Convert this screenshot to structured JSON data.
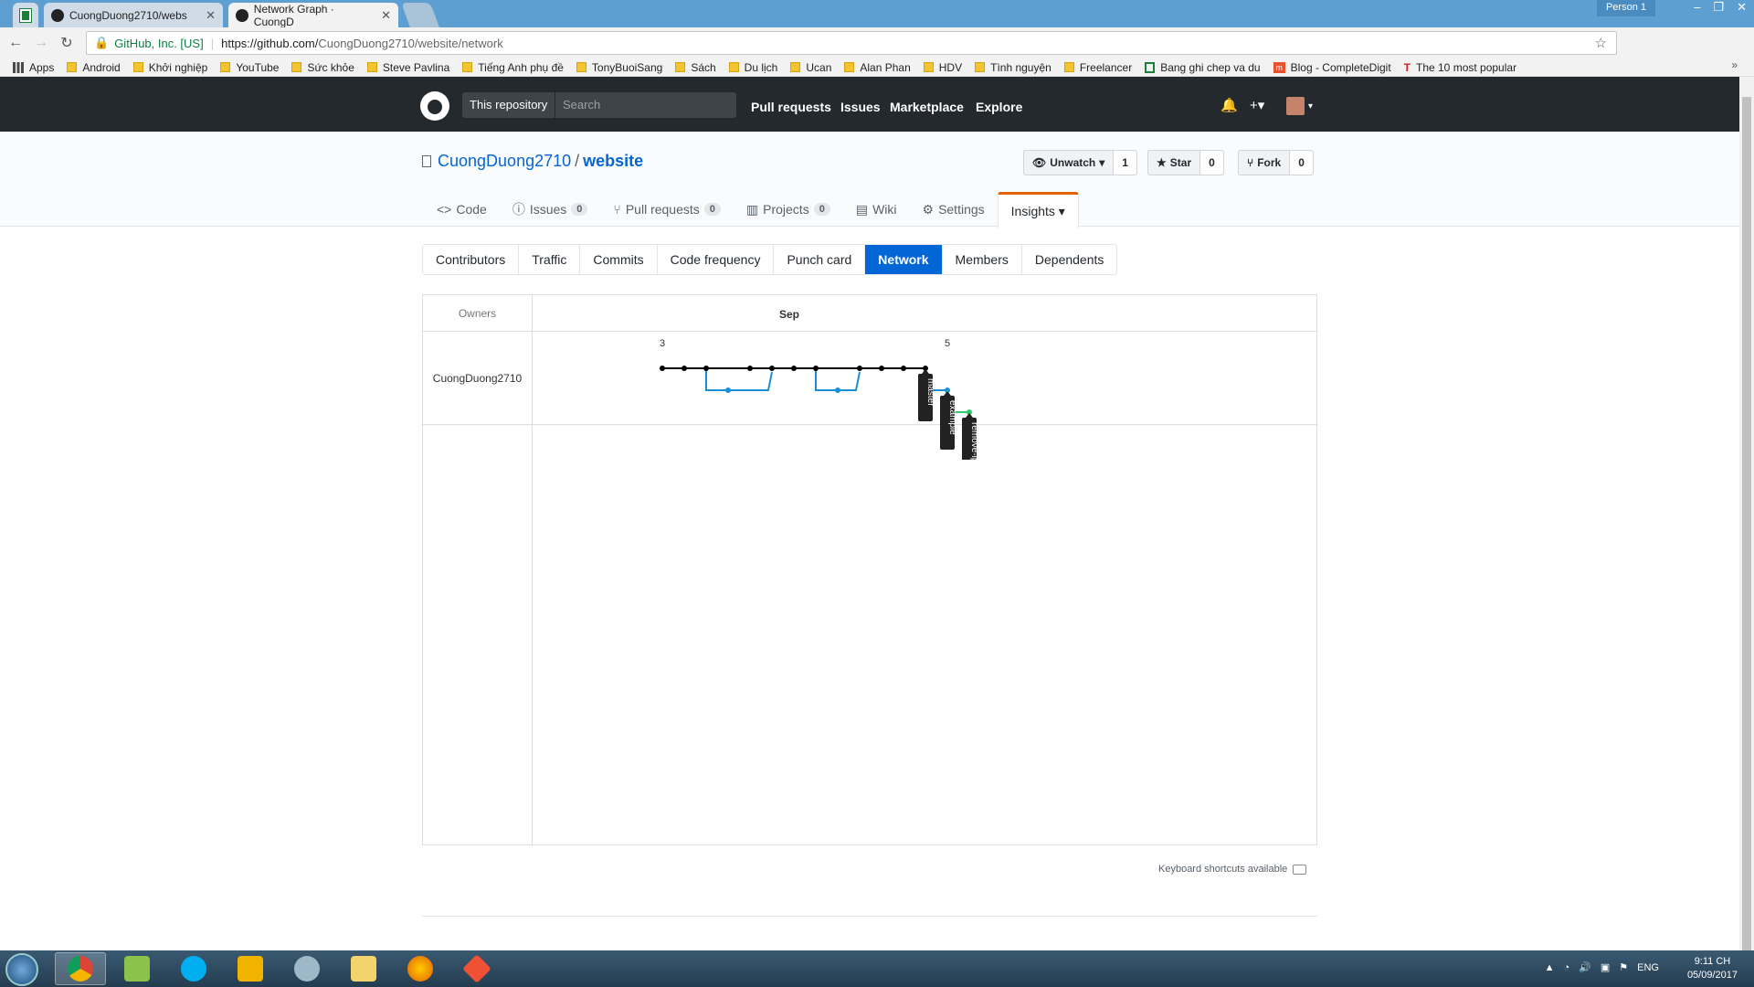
{
  "browser": {
    "tabs": [
      {
        "label": "CuongDuong2710/webs",
        "active": false
      },
      {
        "label": "Network Graph · CuongD",
        "active": true
      }
    ],
    "person": "Person 1",
    "address": {
      "secure_label": "GitHub, Inc. [US]",
      "url_base": "https://github.com/",
      "url_path": "CuongDuong2710/website/network"
    },
    "extensions": [
      "K",
      "IQ"
    ]
  },
  "bookmarks": [
    {
      "label": "Apps",
      "icon": "apps-grid-icon"
    },
    {
      "label": "Android",
      "icon": "folder-icon"
    },
    {
      "label": "Khởi nghiệp",
      "icon": "folder-icon"
    },
    {
      "label": "YouTube",
      "icon": "folder-icon"
    },
    {
      "label": "Sức khỏe",
      "icon": "folder-icon"
    },
    {
      "label": "Steve Pavlina",
      "icon": "folder-icon"
    },
    {
      "label": "Tiếng Anh phụ đề",
      "icon": "folder-icon"
    },
    {
      "label": "TonyBuoiSang",
      "icon": "folder-icon"
    },
    {
      "label": "Sách",
      "icon": "folder-icon"
    },
    {
      "label": "Du lịch",
      "icon": "folder-icon"
    },
    {
      "label": "Ucan",
      "icon": "folder-icon"
    },
    {
      "label": "Alan Phan",
      "icon": "folder-icon"
    },
    {
      "label": "HDV",
      "icon": "folder-icon"
    },
    {
      "label": "Tình nguyện",
      "icon": "folder-icon"
    },
    {
      "label": "Freelancer",
      "icon": "folder-icon"
    },
    {
      "label": "Bang ghi chep va du",
      "icon": "sheets-icon"
    },
    {
      "label": "Blog - CompleteDigit",
      "icon": "m-icon"
    },
    {
      "label": "The 10 most popular",
      "icon": "t-icon"
    }
  ],
  "github": {
    "scope_label": "This repository",
    "search_placeholder": "Search",
    "nav": [
      "Pull requests",
      "Issues",
      "Marketplace",
      "Explore"
    ],
    "plus": "+▾",
    "owner": "CuongDuong2710",
    "repo": "website",
    "watch": {
      "label": "Unwatch",
      "count": "1"
    },
    "star": {
      "label": "Star",
      "count": "0"
    },
    "fork": {
      "label": "Fork",
      "count": "0"
    },
    "repo_tabs": [
      {
        "label": "Code",
        "icon": "code-icon",
        "count": null
      },
      {
        "label": "Issues",
        "icon": "issue-icon",
        "count": "0"
      },
      {
        "label": "Pull requests",
        "icon": "pr-icon",
        "count": "0"
      },
      {
        "label": "Projects",
        "icon": "project-icon",
        "count": "0"
      },
      {
        "label": "Wiki",
        "icon": "book-icon",
        "count": null
      },
      {
        "label": "Settings",
        "icon": "gear-icon",
        "count": null
      },
      {
        "label": "Insights ▾",
        "icon": null,
        "count": null,
        "selected": true
      }
    ],
    "insight_tabs": [
      "Contributors",
      "Traffic",
      "Commits",
      "Code frequency",
      "Punch card",
      "Network",
      "Members",
      "Dependents"
    ],
    "selected_insight": "Network"
  },
  "network": {
    "owners_header": "Owners",
    "month": "Sep",
    "day_labels": [
      {
        "text": "3",
        "col": 0
      },
      {
        "text": "5",
        "col": 13
      }
    ],
    "owners": [
      "CuongDuong2710"
    ],
    "branch_labels": [
      "master",
      "example",
      "remove-ipsum"
    ],
    "colors": {
      "master": "#000000",
      "blue": "#1a8fd8",
      "green": "#2ecc71"
    },
    "keyboard_hint": "Keyboard shortcuts available"
  },
  "taskbar": {
    "lang": "ENG",
    "time": "9:11 CH",
    "date": "05/09/2017"
  }
}
